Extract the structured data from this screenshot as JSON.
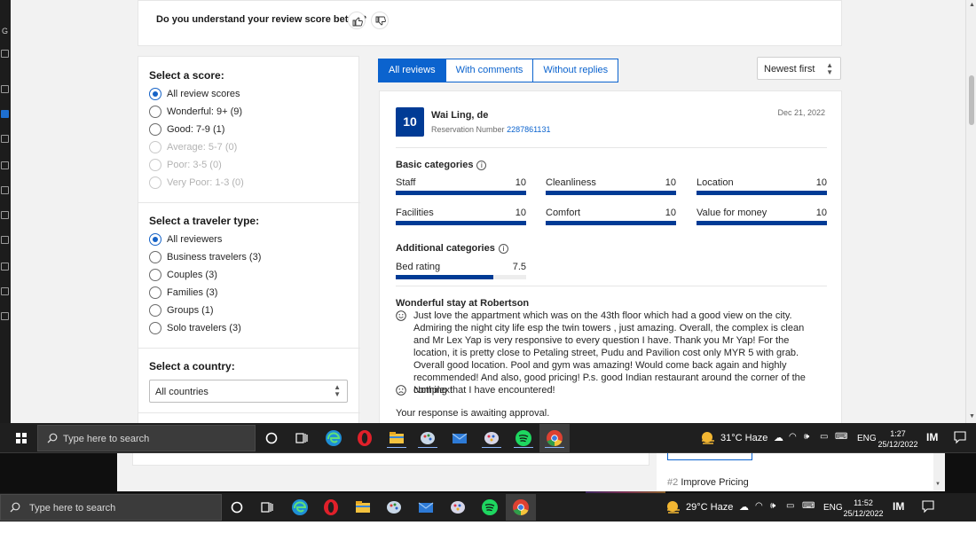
{
  "feedback": {
    "question": "Do you understand your review score better?"
  },
  "filters": {
    "score": {
      "title": "Select a score:",
      "options": [
        {
          "label": "All review scores",
          "selected": true,
          "disabled": false
        },
        {
          "label": "Wonderful: 9+ (9)",
          "selected": false,
          "disabled": false
        },
        {
          "label": "Good: 7-9 (1)",
          "selected": false,
          "disabled": false
        },
        {
          "label": "Average: 5-7 (0)",
          "selected": false,
          "disabled": true
        },
        {
          "label": "Poor: 3-5 (0)",
          "selected": false,
          "disabled": true
        },
        {
          "label": "Very Poor: 1-3 (0)",
          "selected": false,
          "disabled": true
        }
      ]
    },
    "traveler": {
      "title": "Select a traveler type:",
      "options": [
        {
          "label": "All reviewers",
          "selected": true
        },
        {
          "label": "Business travelers (3)",
          "selected": false
        },
        {
          "label": "Couples (3)",
          "selected": false
        },
        {
          "label": "Families (3)",
          "selected": false
        },
        {
          "label": "Groups (1)",
          "selected": false
        },
        {
          "label": "Solo travelers (3)",
          "selected": false
        }
      ]
    },
    "country": {
      "title": "Select a country:",
      "value": "All countries"
    }
  },
  "tabs": [
    {
      "label": "All reviews",
      "active": true
    },
    {
      "label": "With comments",
      "active": false
    },
    {
      "label": "Without replies",
      "active": false
    }
  ],
  "sort": {
    "value": "Newest first"
  },
  "review": {
    "score": "10",
    "reviewer": "Wai Ling, de",
    "reservation_label": "Reservation Number",
    "reservation_number": "2287861131",
    "date": "Dec 21, 2022",
    "basic_title": "Basic categories",
    "basic": [
      {
        "label": "Staff",
        "value": "10",
        "fraction": 1.0
      },
      {
        "label": "Cleanliness",
        "value": "10",
        "fraction": 1.0
      },
      {
        "label": "Location",
        "value": "10",
        "fraction": 1.0
      },
      {
        "label": "Facilities",
        "value": "10",
        "fraction": 1.0
      },
      {
        "label": "Comfort",
        "value": "10",
        "fraction": 1.0
      },
      {
        "label": "Value for money",
        "value": "10",
        "fraction": 1.0
      }
    ],
    "additional_title": "Additional categories",
    "additional": [
      {
        "label": "Bed rating",
        "value": "7.5",
        "fraction": 0.75
      }
    ],
    "title": "Wonderful stay at Robertson",
    "positive": "Just love the appartment which was on the 43th floor which had a good view on the city. Admiring the night city life esp the twin towers , just amazing. Overall, the complex is clean and Mr Lex Yap is very responsive to every question I have. Thank you Mr Yap! For the location, it is pretty close to Petaling street, Pudu and Pavilion cost only MYR 5 with grab. Overall good location. Pool and gym was amazing! Would come back again and highly recommended! And also, good pricing! P.s. good Indian restaurant around the corner of the complex!",
    "negative": "Nothing that I have encountered!",
    "status": "Your response is awaiting approval."
  },
  "left_strip_letter": "G",
  "taskbar1": {
    "search_placeholder": "Type here to search",
    "weather": "31°C  Haze",
    "lang": "ENG",
    "time": "1:27",
    "date": "25/12/2022"
  },
  "under": {
    "improve_num": "#2",
    "improve_label": "Improve Pricing"
  },
  "taskbar2": {
    "search_placeholder": "Type here to search",
    "weather": "29°C  Haze",
    "lang": "ENG",
    "time": "11:52",
    "date": "25/12/2022"
  },
  "colors": {
    "brand": "#003b95",
    "link": "#0b63ce",
    "taskbar": "#1f1f1f"
  }
}
